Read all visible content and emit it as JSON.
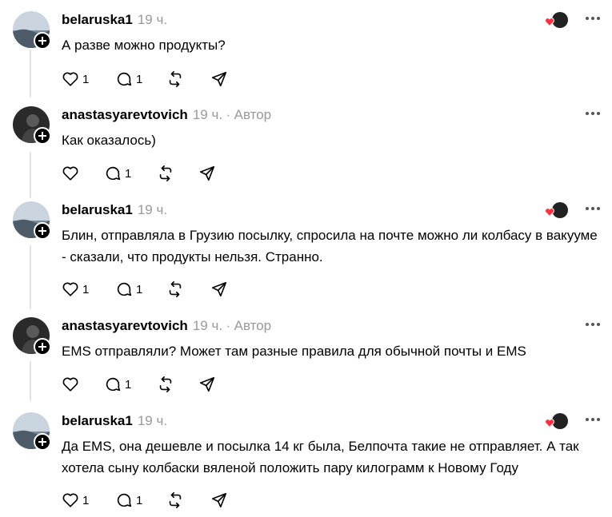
{
  "comments": [
    {
      "username": "belaruska1",
      "time": "19 ч.",
      "author_label": "",
      "text": "А разве можно продукты?",
      "likes": "1",
      "replies": "1",
      "has_liked_badge": true
    },
    {
      "username": "anastasyarevtovich",
      "time": "19 ч.",
      "author_label": "Автор",
      "text": "Как оказалось)",
      "likes": "",
      "replies": "1",
      "has_liked_badge": false
    },
    {
      "username": "belaruska1",
      "time": "19 ч.",
      "author_label": "",
      "text": "Блин, отправляла в Грузию посылку, спросила на почте можно ли колбасу в вакууме - сказали, что продукты нельзя. Странно.",
      "likes": "1",
      "replies": "1",
      "has_liked_badge": true
    },
    {
      "username": "anastasyarevtovich",
      "time": "19 ч.",
      "author_label": "Автор",
      "text": "EMS отправляли? Может там разные правила для обычной почты и EMS",
      "likes": "",
      "replies": "1",
      "has_liked_badge": false
    },
    {
      "username": "belaruska1",
      "time": "19 ч.",
      "author_label": "",
      "text": "Да EMS, она дешевле и посылка 14 кг была, Белпочта такие не отправляет. А так хотела сыну колбаски вяленой положить пару килограмм к Новому Году",
      "likes": "1",
      "replies": "1",
      "has_liked_badge": true
    }
  ],
  "separator": "·",
  "colors": {
    "heart_badge": "#ff3040",
    "muted_text": "#999999",
    "thread_line": "#e2e2e2"
  },
  "icons": [
    "heart-icon",
    "comment-icon",
    "repost-icon",
    "share-icon",
    "more-icon",
    "follow-plus-icon"
  ]
}
